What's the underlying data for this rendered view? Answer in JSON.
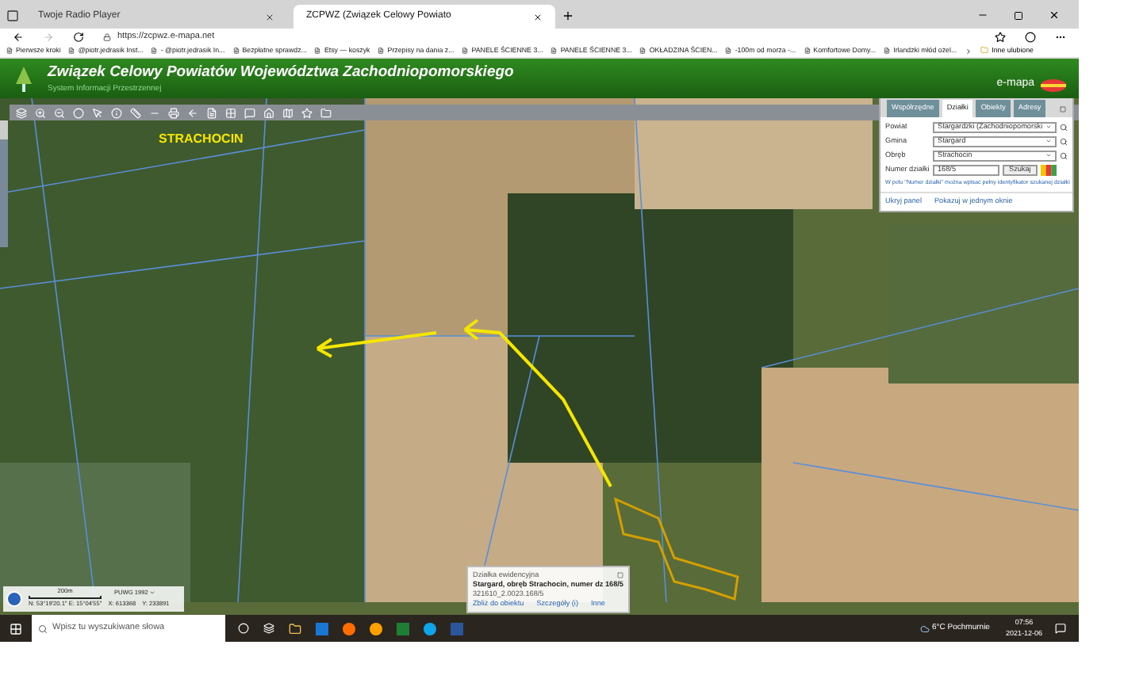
{
  "browser": {
    "tabs": [
      {
        "label": "Twoje Radio Player",
        "selected": false
      },
      {
        "label": "ZCPWZ (Związek Celowy Powiato",
        "selected": true
      }
    ],
    "url": "https://zcpwz.e-mapa.net",
    "bookmarks": [
      "Pierwsze kroki",
      "@piotr.jedrasik Inst...",
      "- @piotr.jedrasik In...",
      "Bezpłatne sprawdz...",
      "Etsy — koszyk",
      "Przepisy na dania z...",
      "PANELE ŚCIENNE 3...",
      "PANELE ŚCIENNE 3...",
      "OKŁADZINA ŚCIEN...",
      "-100m od morza -...",
      "Komfortowe Domy...",
      "Irlandzki młód ożel..."
    ],
    "other_bookmarks": "Inne ulubione"
  },
  "header": {
    "title": "Związek Celowy Powiatów Województwa Zachodniopomorskiego",
    "subtitle": "System Informacji Przestrzennej",
    "logo": "e-mapa"
  },
  "map": {
    "zoom": {
      "level": 0.85
    },
    "place_label": "STRACHOCIN",
    "scale": "200m",
    "projection": "PUWG 1992",
    "coordinates": "N: 53°19'20.1\" E: 15°04'55\"",
    "x": "X: 613368",
    "y": "Y: 233891"
  },
  "search_panel": {
    "tabs": [
      {
        "label": "Współrzędne",
        "selected": false
      },
      {
        "label": "Działki",
        "selected": true
      },
      {
        "label": "Obiekty",
        "selected": false
      },
      {
        "label": "Adresy",
        "selected": false
      }
    ],
    "fields": [
      {
        "label": "Powiat",
        "value": "Stargardzki (Zachodniopomorski"
      },
      {
        "label": "Gmina",
        "value": "Stargard"
      },
      {
        "label": "Obręb",
        "value": "Strachocin"
      }
    ],
    "parcel_label": "Numer działki",
    "parcel_value": "168/5",
    "search_button": "Szukaj",
    "hint": "W polu \"Numer działki\" można wpisać pełny identyfikator szukanej działki",
    "links": [
      "Ukryj panel",
      "Pokazuj w jednym oknie"
    ]
  },
  "popup": {
    "title": "Działka ewidencyjna",
    "description": "Stargard, obręb Strachocin, numer dz 168/5",
    "identifier": "321610_2.0023.168/5",
    "links": [
      "Zbliż do obiektu",
      "Szczegóły (i)",
      "Inne"
    ]
  },
  "taskbar": {
    "search_placeholder": "Wpisz tu wyszukiwane słowa",
    "weather": "6°C Pochmurnie",
    "time": "07:56",
    "date": "2021-12-06"
  }
}
